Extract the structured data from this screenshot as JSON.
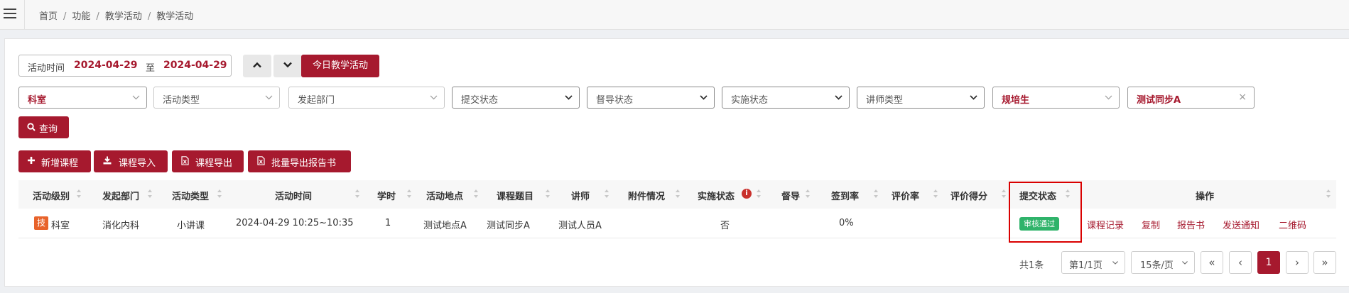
{
  "breadcrumb": [
    "首页",
    "功能",
    "教学活动",
    "教学活动"
  ],
  "date_filter": {
    "label": "活动时间",
    "start": "2024-04-29",
    "sep": "至",
    "end": "2024-04-29"
  },
  "today_button": "今日教学活动",
  "filters": {
    "dept": "科室",
    "activity_type": "活动类型",
    "initiating_dept": "发起部门",
    "submit_status": "提交状态",
    "supervise_status": "督导状态",
    "implement_status": "实施状态",
    "lecturer_type": "讲师类型",
    "trainee_type": "规培生",
    "course": "测试同步A"
  },
  "query_button": "查询",
  "actions": [
    "新增课程",
    "课程导入",
    "课程导出",
    "批量导出报告书"
  ],
  "columns": [
    "活动级别",
    "发起部门",
    "活动类型",
    "活动时间",
    "学时",
    "活动地点",
    "课程题目",
    "讲师",
    "附件情况",
    "实施状态",
    "督导",
    "签到率",
    "评价率",
    "评价得分",
    "提交状态",
    "操作"
  ],
  "rows": [
    {
      "level_tag": "技",
      "level": "科室",
      "initiating_dept": "消化内科",
      "activity_type": "小讲课",
      "time": "2024-04-29 10:25~10:35",
      "hours": "1",
      "location": "测试地点A",
      "course": "测试同步A",
      "lecturer": "测试人员A",
      "attachment": "",
      "implement_status": "否",
      "supervise": "",
      "sign_rate": "0%",
      "eval_rate": "",
      "eval_score": "",
      "submit_status": "审核通过",
      "operations": [
        "课程记录",
        "复制",
        "报告书",
        "发送通知",
        "二维码"
      ]
    }
  ],
  "pagination": {
    "total": "共1条",
    "page": "第1/1页",
    "page_size": "15条/页",
    "current": "1",
    "first": "«",
    "prev": "‹",
    "next": "›",
    "last": "»"
  },
  "colors": {
    "primary": "#a6192e",
    "success": "#2fb36a",
    "tag": "#e8632b",
    "highlight_box": "#d90000"
  }
}
